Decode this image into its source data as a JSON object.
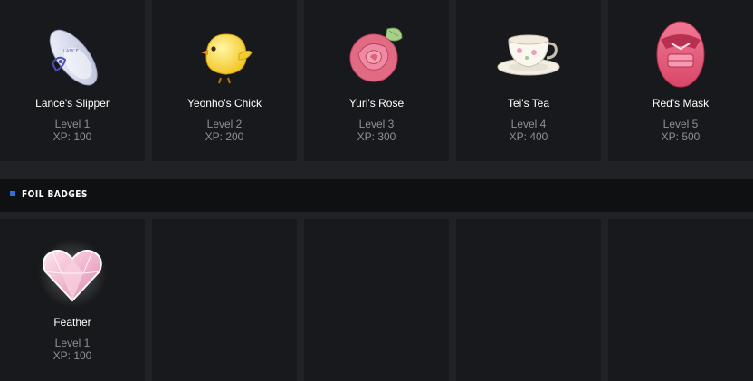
{
  "badges": [
    {
      "name": "Lance's Slipper",
      "level": "Level 1",
      "xp": "XP: 100",
      "icon": "slipper-icon"
    },
    {
      "name": "Yeonho's Chick",
      "level": "Level 2",
      "xp": "XP: 200",
      "icon": "chick-icon"
    },
    {
      "name": "Yuri's Rose",
      "level": "Level 3",
      "xp": "XP: 300",
      "icon": "rose-icon"
    },
    {
      "name": "Tei's Tea",
      "level": "Level 4",
      "xp": "XP: 400",
      "icon": "teacup-icon"
    },
    {
      "name": "Red's Mask",
      "level": "Level 5",
      "xp": "XP: 500",
      "icon": "mask-icon"
    }
  ],
  "foil_section": {
    "title": "FOIL BADGES",
    "badges": [
      {
        "name": "Feather",
        "level": "Level 1",
        "xp": "XP: 100",
        "icon": "crystal-heart-icon"
      }
    ]
  },
  "colors": {
    "background": "#212226",
    "card": "#18191c",
    "section_bar": "#0f1012",
    "accent": "#2f6fd6",
    "muted_text": "#8e8f94"
  }
}
